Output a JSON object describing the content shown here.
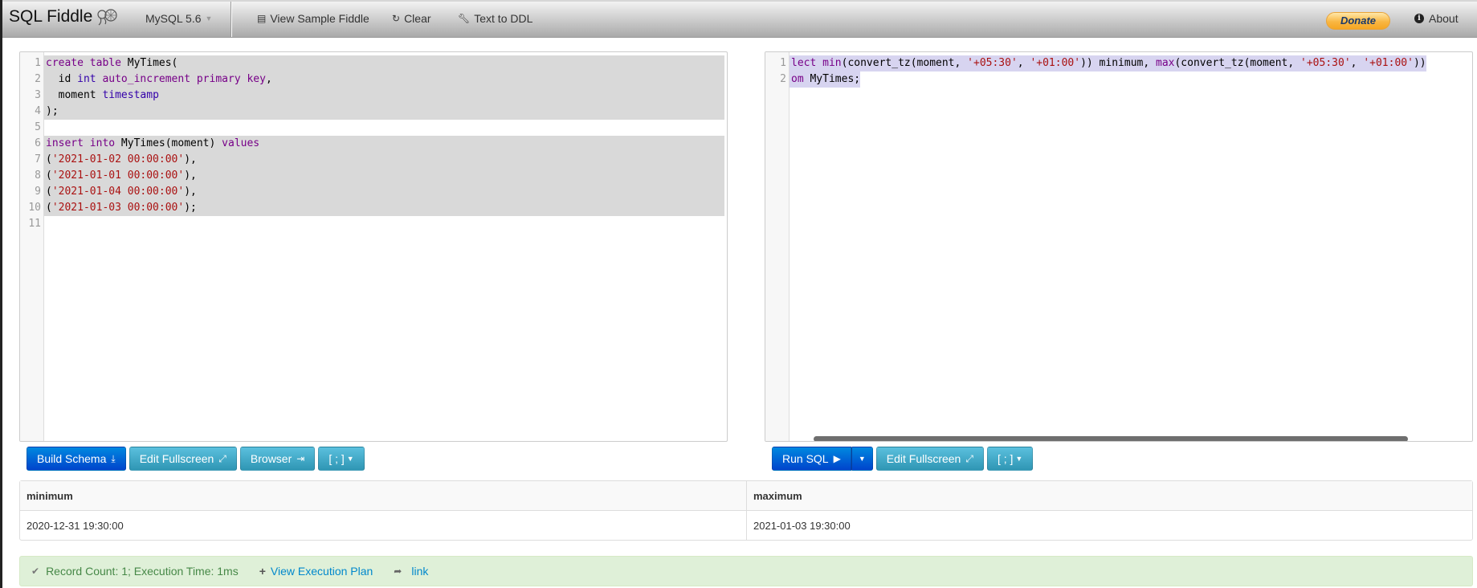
{
  "navbar": {
    "brand": "SQL Fiddle",
    "db_select": "MySQL 5.6",
    "links": {
      "view_sample": "View Sample Fiddle",
      "clear": "Clear",
      "text_to_ddl": "Text to DDL"
    },
    "donate": "Donate",
    "about": "About",
    "info_glyph": "i"
  },
  "schema_editor": {
    "lines": [
      [
        {
          "t": "kw",
          "v": "create"
        },
        {
          "t": "plain",
          "v": " "
        },
        {
          "t": "kw",
          "v": "table"
        },
        {
          "t": "plain",
          "v": " MyTimes("
        }
      ],
      [
        {
          "t": "plain",
          "v": "  id "
        },
        {
          "t": "ty",
          "v": "int"
        },
        {
          "t": "plain",
          "v": " "
        },
        {
          "t": "kw",
          "v": "auto_increment"
        },
        {
          "t": "plain",
          "v": " "
        },
        {
          "t": "kw",
          "v": "primary"
        },
        {
          "t": "plain",
          "v": " "
        },
        {
          "t": "kw",
          "v": "key"
        },
        {
          "t": "plain",
          "v": ","
        }
      ],
      [
        {
          "t": "plain",
          "v": "  moment "
        },
        {
          "t": "ty",
          "v": "timestamp"
        }
      ],
      [
        {
          "t": "plain",
          "v": ");"
        }
      ],
      [],
      [
        {
          "t": "kw",
          "v": "insert"
        },
        {
          "t": "plain",
          "v": " "
        },
        {
          "t": "kw",
          "v": "into"
        },
        {
          "t": "plain",
          "v": " MyTimes(moment) "
        },
        {
          "t": "kw",
          "v": "values"
        }
      ],
      [
        {
          "t": "plain",
          "v": "("
        },
        {
          "t": "st",
          "v": "'2021-01-02 00:00:00'"
        },
        {
          "t": "plain",
          "v": "),"
        }
      ],
      [
        {
          "t": "plain",
          "v": "("
        },
        {
          "t": "st",
          "v": "'2021-01-01 00:00:00'"
        },
        {
          "t": "plain",
          "v": "),"
        }
      ],
      [
        {
          "t": "plain",
          "v": "("
        },
        {
          "t": "st",
          "v": "'2021-01-04 00:00:00'"
        },
        {
          "t": "plain",
          "v": "),"
        }
      ],
      [
        {
          "t": "plain",
          "v": "("
        },
        {
          "t": "st",
          "v": "'2021-01-03 00:00:00'"
        },
        {
          "t": "plain",
          "v": ");"
        }
      ],
      []
    ],
    "selected_lines": 10
  },
  "query_editor": {
    "lines": [
      [
        {
          "t": "kw",
          "v": "lect"
        },
        {
          "t": "plain",
          "v": " "
        },
        {
          "t": "kw",
          "v": "min"
        },
        {
          "t": "plain",
          "v": "(convert_tz(moment, "
        },
        {
          "t": "st",
          "v": "'+05:30'"
        },
        {
          "t": "plain",
          "v": ", "
        },
        {
          "t": "st",
          "v": "'+01:00'"
        },
        {
          "t": "plain",
          "v": ")) minimum, "
        },
        {
          "t": "kw",
          "v": "max"
        },
        {
          "t": "plain",
          "v": "(convert_tz(moment, "
        },
        {
          "t": "st",
          "v": "'+05:30'"
        },
        {
          "t": "plain",
          "v": ", "
        },
        {
          "t": "st",
          "v": "'+01:00'"
        },
        {
          "t": "plain",
          "v": "))"
        }
      ],
      [
        {
          "t": "kw",
          "v": "om"
        },
        {
          "t": "plain",
          "v": " MyTimes;"
        }
      ]
    ],
    "selected_lines": 2
  },
  "schema_buttons": {
    "build": "Build Schema",
    "fullscreen": "Edit Fullscreen",
    "browser": "Browser",
    "terminator": "[ ; ]"
  },
  "query_buttons": {
    "run": "Run SQL",
    "fullscreen": "Edit Fullscreen",
    "terminator": "[ ; ]"
  },
  "results": {
    "columns": [
      "minimum",
      "maximum"
    ],
    "rows": [
      [
        "2020-12-31 19:30:00",
        "2021-01-03 19:30:00"
      ]
    ]
  },
  "status": {
    "message": "Record Count: 1; Execution Time: 1ms",
    "execution_plan": "View Execution Plan",
    "link": "link"
  }
}
